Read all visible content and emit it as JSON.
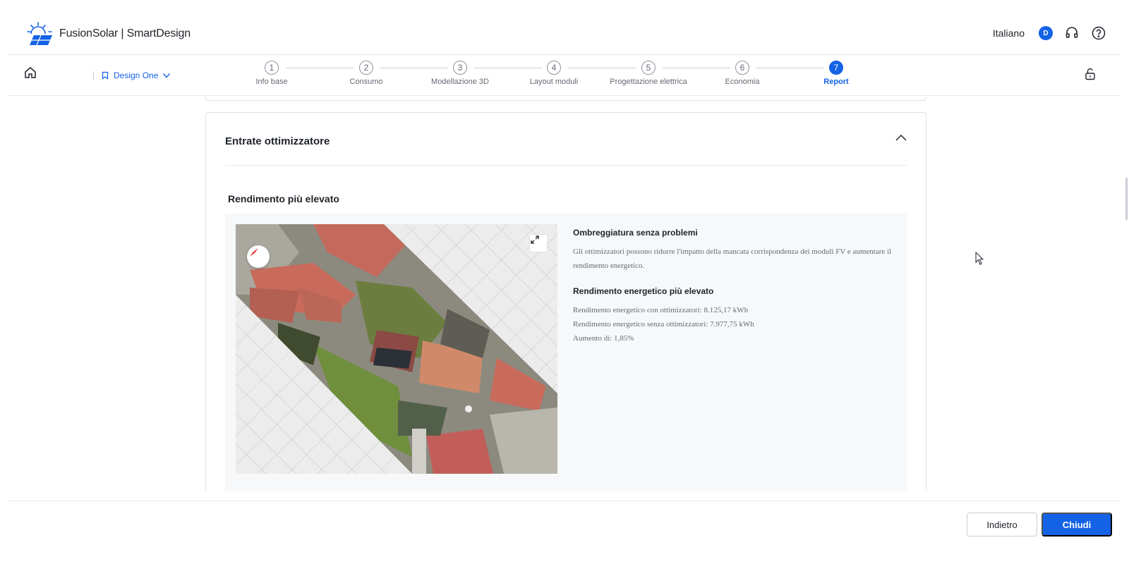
{
  "header": {
    "app_title": "FusionSolar | SmartDesign",
    "language": "Italiano",
    "avatar_initial": "D"
  },
  "nav": {
    "design_name": "Design One",
    "steps": [
      {
        "number": "1",
        "label": "Info base"
      },
      {
        "number": "2",
        "label": "Consumo"
      },
      {
        "number": "3",
        "label": "Modellazione 3D"
      },
      {
        "number": "4",
        "label": "Layout moduli"
      },
      {
        "number": "5",
        "label": "Progettazione elettrica"
      },
      {
        "number": "6",
        "label": "Economia"
      },
      {
        "number": "7",
        "label": "Report"
      }
    ],
    "active_step": 7
  },
  "card": {
    "title": "Entrate ottimizzatore",
    "section_title": "Rendimento più elevato",
    "block1_title": "Ombreggiatura senza problemi",
    "block1_text": "Gli ottimizzatori possono ridurre l'impatto della mancata corrispondenza dei moduli FV e aumentare il rendimento energetico.",
    "block2_title": "Rendimento energetico più elevato",
    "lines": [
      "Rendimento energetico con ottimizzatori:  8.125,17 kWh",
      "Rendimento energetico senza ottimizzatori:  7.977,75 kWh",
      "Aumento di:  1,85%"
    ]
  },
  "footer": {
    "back_label": "Indietro",
    "close_label": "Chiudi"
  },
  "colors": {
    "accent": "#1462e6"
  }
}
